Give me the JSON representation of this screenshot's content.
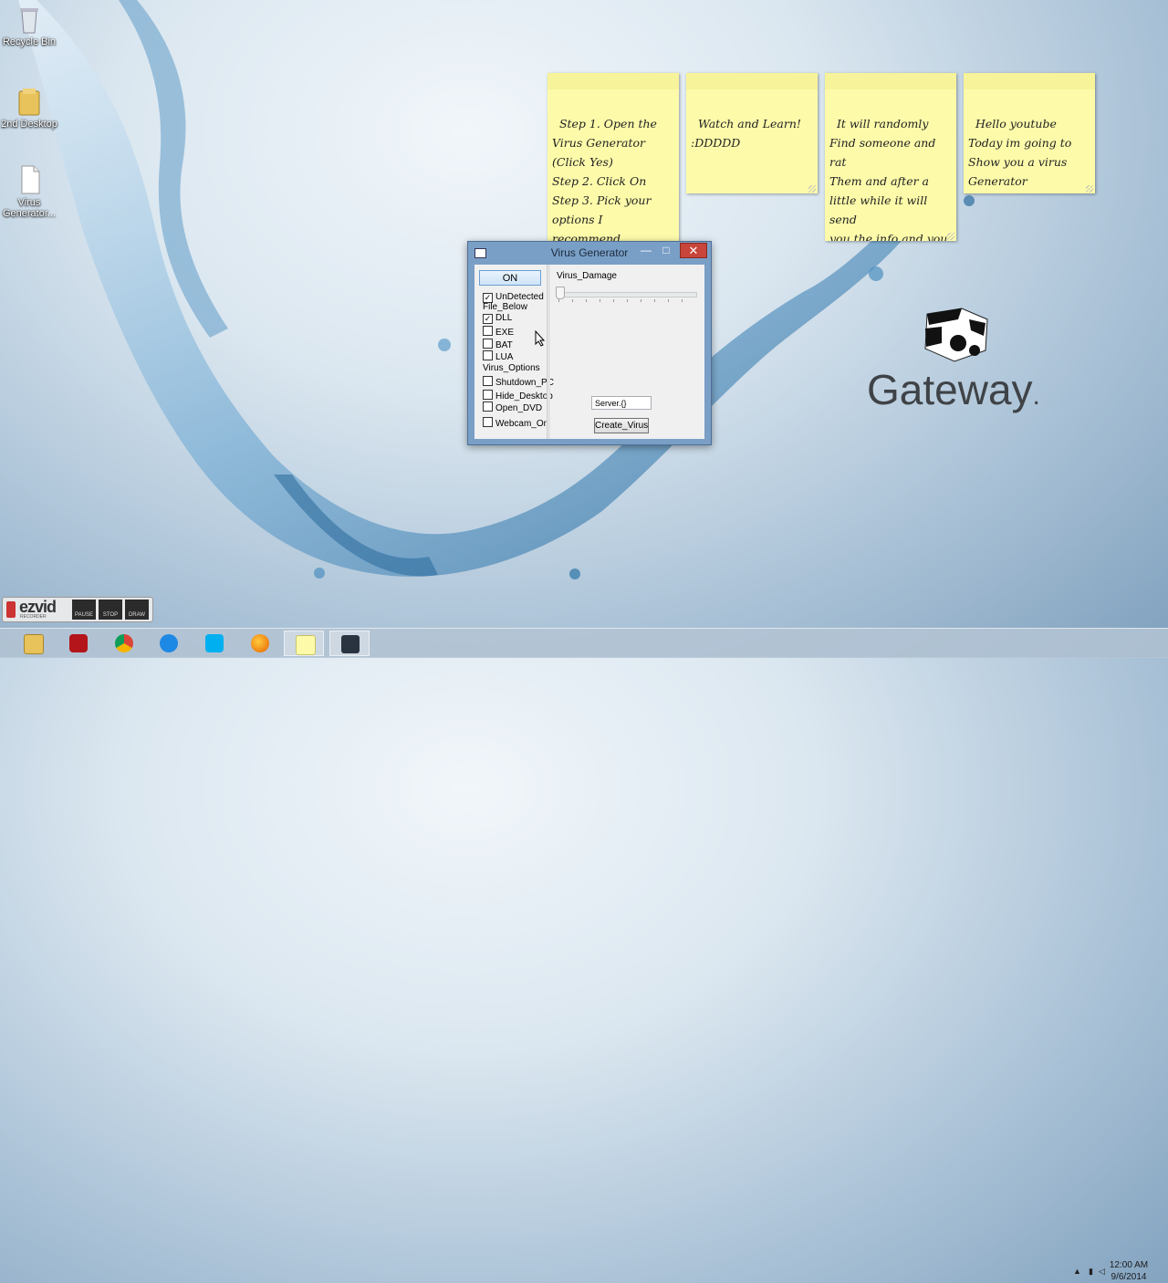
{
  "desktop": {
    "icons": [
      {
        "label": "Recycle Bin"
      },
      {
        "label": "2nd Desktop"
      },
      {
        "label": "Virus Generator..."
      }
    ]
  },
  "notes": [
    {
      "text": "Step 1. Open the\nVirus Generator\n(Click Yes)\nStep 2. Click On\nStep 3. Pick your\noptions I recommend\nthese (Only use one\nOf these)"
    },
    {
      "text": "Watch and Learn!\n:DDDDD"
    },
    {
      "text": "It will randomly\nFind someone and rat\nThem and after a\nlittle while it will send\nyou the info and you\nwill see all their info\n:D"
    },
    {
      "text": "Hello youtube\nToday im going to\nShow you a virus\nGenerator"
    }
  ],
  "window": {
    "title": "Virus Generator",
    "minimize": "—",
    "maximize": "□",
    "close": "✕",
    "on_button": "ON",
    "undetected": {
      "label": "UnDetected",
      "checked": true
    },
    "file_below_label": "File_Below",
    "file_types": [
      {
        "label": "DLL",
        "checked": true
      },
      {
        "label": "EXE",
        "checked": false
      },
      {
        "label": "BAT",
        "checked": false
      },
      {
        "label": "LUA",
        "checked": false
      }
    ],
    "virus_options_label": "Virus_Options",
    "options": [
      {
        "label": "Shutdown_PC",
        "checked": false
      },
      {
        "label": "Hide_Desktop",
        "checked": false
      },
      {
        "label": "Open_DVD",
        "checked": false
      },
      {
        "label": "Webcam_On",
        "checked": false
      }
    ],
    "damage_label": "Virus_Damage",
    "damage_value": 0,
    "server_value": "Server.{}",
    "create_button": "Create_Virus"
  },
  "branding": {
    "gateway": "Gateway",
    "gateway_dot": "."
  },
  "recorder": {
    "logo": "ezvid",
    "sub": "RECORDER",
    "pause": "PAUSE",
    "stop": "STOP",
    "draw": "DRAW"
  },
  "taskbar": {
    "apps": [
      "file-explorer-icon",
      "power-icon",
      "chrome-icon",
      "internet-explorer-icon",
      "skype-icon",
      "firefox-icon",
      "sticky-notes-icon",
      "virus-generator-icon"
    ],
    "tray_arrow": "▲",
    "time": "12:00 AM",
    "date": "9/6/2014"
  },
  "colors": {
    "note_bg": "#fdfbaa",
    "close_red": "#c7453a",
    "window_frame": "#7a9fc7"
  }
}
